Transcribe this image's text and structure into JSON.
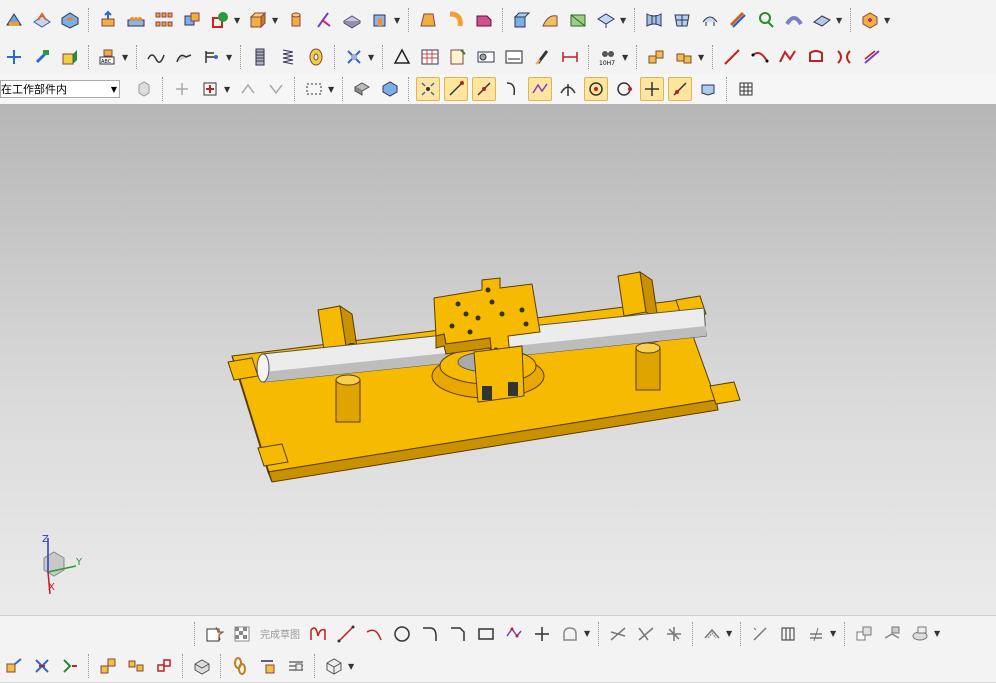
{
  "toolbar": {
    "scope_select": {
      "value": "在工作部件内"
    }
  },
  "sketch_toolbar": {
    "finish_sketch_label": "完成草图"
  },
  "viewport": {
    "triad": {
      "z_label": "Z",
      "y_label": "Y",
      "x_label": "X"
    },
    "colors": {
      "part": "#f5b800",
      "part_shadow": "#c98f00",
      "shaft": "#e8e8e8",
      "bg_top": "#b6b6b6",
      "bg_bottom": "#ebebeb"
    }
  },
  "icons": {
    "row1": [
      "blend-icon",
      "offset-face-icon",
      "shell-icon",
      "extrude-icon",
      "pattern-feature-icon",
      "array-icon",
      "unite-icon",
      "sketch-icon",
      "block-icon",
      "cylinder-icon",
      "trim-body-icon",
      "thicken-icon",
      "box-section-icon",
      "draft-icon",
      "sweep-icon",
      "chamfer-icon",
      "sew-icon",
      "surface-icon",
      "bounded-plane-icon",
      "through-curves-icon",
      "mesh-icon",
      "studio-surface-icon",
      "law-extension-icon",
      "analysis-icon",
      "morph-icon",
      "assembly-icon"
    ],
    "row2": [
      "move-face-icon",
      "hammer-icon",
      "measure-icon",
      "text-icon",
      "wave-icon",
      "dimension-icon",
      "bar-icon",
      "thread-icon",
      "spring-icon",
      "coil-icon",
      "tool-icon",
      "triangle-icon",
      "table-icon",
      "sheet-icon",
      "gdt-icon",
      "note-icon",
      "ruler-icon",
      "tolerance-icon",
      "component-icon",
      "component-add-icon",
      "line-icon",
      "arc-icon",
      "spline-icon",
      "outline-icon",
      "mirror-curve-icon"
    ],
    "row3": [
      "hidden-part-icon",
      "move-icon",
      "orient-icon",
      "rotate-icon",
      "rectangle-select-icon",
      "show-icon",
      "filter-icon",
      "snap-point-icon",
      "snap-line-icon",
      "snap-edge-icon",
      "curve-rule-icon",
      "intersection-icon",
      "angle-icon",
      "center-icon",
      "quadrant-icon",
      "plus-icon",
      "tangent-icon",
      "face-icon",
      "grid-icon"
    ],
    "bottom1": [
      "sketch-frame-icon",
      "finish-flag-icon",
      "profile-icon",
      "line-sketch-icon",
      "arc-sketch-icon",
      "circle-icon",
      "fillet-icon",
      "chamfer-sketch-icon",
      "rectangle-icon",
      "polygon-icon",
      "point-icon",
      "shape-icon",
      "quick-trim-icon",
      "extend-icon",
      "corner-icon",
      "offset-icon",
      "mirror-icon",
      "pattern-icon",
      "constraint-icon",
      "auto-constraint-icon",
      "show-constraints-icon",
      "convert-icon"
    ],
    "bottom2": [
      "view-icon",
      "joint-icon",
      "motion-icon",
      "assembly-sequence-icon",
      "component-array-icon",
      "replace-icon",
      "clearance-icon",
      "constraint-link-icon",
      "explode-icon",
      "wave-link-icon",
      "package-icon"
    ]
  }
}
